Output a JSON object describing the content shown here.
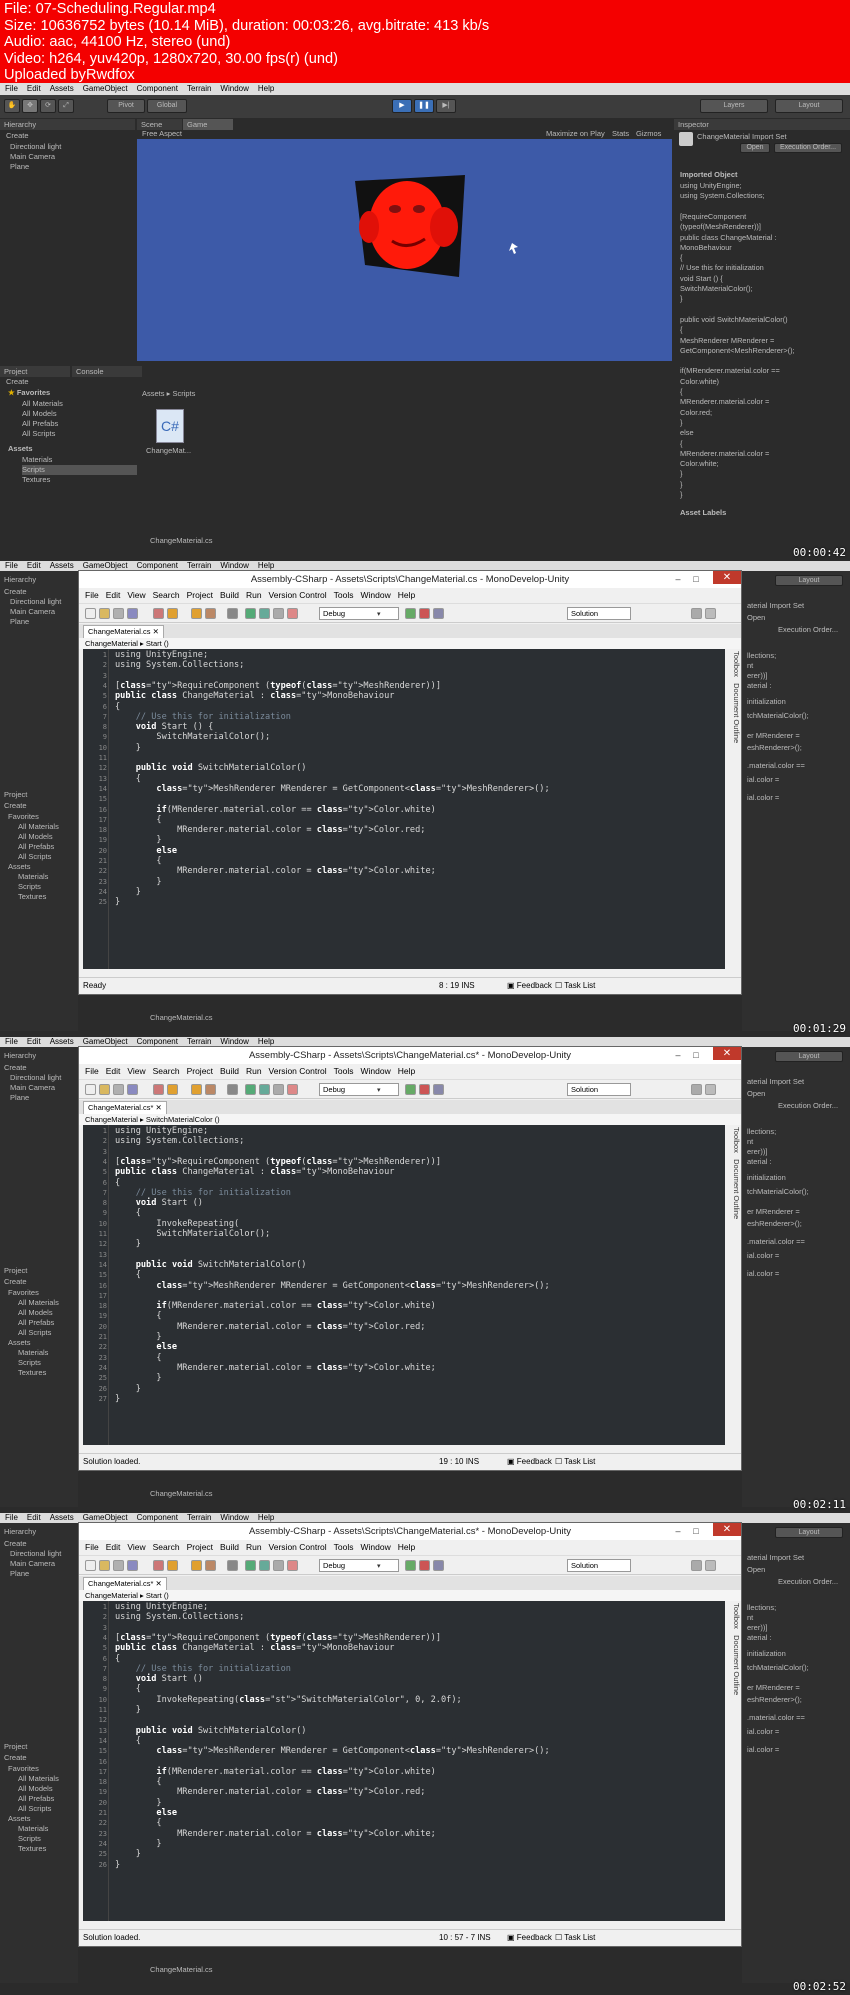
{
  "header": {
    "lines": [
      "File: 07-Scheduling.Regular.mp4",
      "Size: 10636752 bytes (10.14 MiB), duration: 00:03:26, avg.bitrate: 413 kb/s",
      "Audio: aac, 44100 Hz, stereo (und)",
      "Video: h264, yuv420p, 1280x720, 30.00 fps(r) (und)",
      "Uploaded byRwdfox"
    ]
  },
  "frame1": {
    "timestamp": "00:00:42",
    "menu": [
      "File",
      "Edit",
      "Assets",
      "GameObject",
      "Component",
      "Terrain",
      "Window",
      "Help"
    ],
    "toolbar": {
      "pivot": "Pivot",
      "global": "Global",
      "layers": "Layers",
      "layout": "Layout"
    },
    "hierarchy": {
      "title": "Hierarchy",
      "create": "Create",
      "items": [
        "Directional light",
        "Main Camera",
        "Plane"
      ]
    },
    "scene_tab": "Scene",
    "game_tab": "Game",
    "free_aspect": "Free Aspect",
    "game_opts": [
      "Maximize on Play",
      "Stats",
      "Gizmos"
    ],
    "inspector": {
      "title": "Inspector",
      "asset": "ChangeMaterial Import Set",
      "open": "Open",
      "exec": "Execution Order...",
      "imported": "Imported Object",
      "code": [
        "using UnityEngine;",
        "using System.Collections;",
        "",
        "[RequireComponent",
        "(typeof(MeshRenderer))]",
        "public class ChangeMaterial :",
        "MonoBehaviour",
        "{",
        "    // Use this for initialization",
        "    void Start () {",
        "        SwitchMaterialColor();",
        "    }",
        "",
        "    public void SwitchMaterialColor()",
        "    {",
        "        MeshRenderer MRenderer =",
        "GetComponent<MeshRenderer>();",
        "",
        "        if(MRenderer.material.color ==",
        "Color.white)",
        "        {",
        "            MRenderer.material.color =",
        "Color.red;",
        "        }",
        "        else",
        "        {",
        "            MRenderer.material.color =",
        "Color.white;",
        "        }",
        "    }",
        "}"
      ],
      "labels": "Asset Labels"
    },
    "project": {
      "title": "Project",
      "console": "Console",
      "create": "Create",
      "favorites": "Favorites",
      "fav_items": [
        "All Materials",
        "All Models",
        "All Prefabs",
        "All Scripts"
      ],
      "assets": "Assets",
      "asset_items": [
        "Materials",
        "Scripts",
        "Textures"
      ],
      "breadcrumb": "Assets ▸ Scripts",
      "file": "ChangeMat...",
      "status_file": "ChangeMaterial.cs"
    }
  },
  "md_common": {
    "menu": [
      "File",
      "Edit",
      "View",
      "Search",
      "Project",
      "Build",
      "Run",
      "Version Control",
      "Tools",
      "Window",
      "Help"
    ],
    "config": "Debug",
    "solution": "Solution",
    "feedback": "Feedback",
    "task_list": "Task List",
    "toolbox": "Toolbox",
    "doc_outline": "Document Outline",
    "unity_file": "ChangeMaterial.cs",
    "bg_hier": [
      "Hierarchy",
      "Create",
      "Directional light",
      "Main Camera",
      "Plane"
    ],
    "bg_proj": [
      "Project",
      "Create",
      "Favorites",
      "All Materials",
      "All Models",
      "All Prefabs",
      "All Scripts",
      "Assets",
      "Materials",
      "Scripts",
      "Textures"
    ],
    "bg_menu": [
      "File",
      "Edit",
      "Assets",
      "GameObject",
      "Component",
      "Terrain",
      "Window",
      "Help"
    ],
    "bg_layout": "Layout",
    "bg_insp": [
      "aterial Import Set",
      "Open",
      "Execution Order...",
      "llections;",
      "nt",
      "erer))]",
      "aterial :",
      "initialization",
      "tchMaterialColor();",
      "er MRenderer =",
      "eshRenderer>();",
      ".material.color ==",
      "ial.color =",
      "ial.color ="
    ]
  },
  "frame2": {
    "timestamp": "00:01:29",
    "title": "Assembly-CSharp - Assets\\Scripts\\ChangeMaterial.cs - MonoDevelop-Unity",
    "tab": "ChangeMaterial.cs",
    "bc": [
      "ChangeMaterial ▸",
      "Start ()"
    ],
    "status": "Ready",
    "pos": "8 : 19  INS",
    "lines": [
      [
        "using UnityEngine;"
      ],
      [
        "using System.Collections;"
      ],
      [
        ""
      ],
      [
        "[RequireComponent (typeof(MeshRenderer))]"
      ],
      [
        "public class ChangeMaterial : MonoBehaviour"
      ],
      [
        "{"
      ],
      [
        "    // Use this for initialization"
      ],
      [
        "    void Start () {"
      ],
      [
        "        SwitchMaterialColor();"
      ],
      [
        "    }"
      ],
      [
        ""
      ],
      [
        "    public void SwitchMaterialColor()"
      ],
      [
        "    {"
      ],
      [
        "        MeshRenderer MRenderer = GetComponent<MeshRenderer>();"
      ],
      [
        ""
      ],
      [
        "        if(MRenderer.material.color == Color.white)"
      ],
      [
        "        {"
      ],
      [
        "            MRenderer.material.color = Color.red;"
      ],
      [
        "        }"
      ],
      [
        "        else"
      ],
      [
        "        {"
      ],
      [
        "            MRenderer.material.color = Color.white;"
      ],
      [
        "        }"
      ],
      [
        "    }"
      ],
      [
        "}"
      ]
    ]
  },
  "frame3": {
    "timestamp": "00:02:11",
    "title": "Assembly-CSharp - Assets\\Scripts\\ChangeMaterial.cs* - MonoDevelop-Unity",
    "tab": "ChangeMaterial.cs*",
    "bc": [
      "ChangeMaterial ▸",
      "SwitchMaterialColor ()"
    ],
    "status": "Solution loaded.",
    "pos": "19 : 10  INS",
    "lines": [
      [
        "using UnityEngine;"
      ],
      [
        "using System.Collections;"
      ],
      [
        ""
      ],
      [
        "[RequireComponent (typeof(MeshRenderer))]"
      ],
      [
        "public class ChangeMaterial : MonoBehaviour"
      ],
      [
        "{"
      ],
      [
        "    // Use this for initialization"
      ],
      [
        "    void Start ()"
      ],
      [
        "    {"
      ],
      [
        "        InvokeRepeating("
      ],
      [
        "        SwitchMaterialColor();"
      ],
      [
        "    }"
      ],
      [
        ""
      ],
      [
        "    public void SwitchMaterialColor()"
      ],
      [
        "    {"
      ],
      [
        "        MeshRenderer MRenderer = GetComponent<MeshRenderer>();"
      ],
      [
        ""
      ],
      [
        "        if(MRenderer.material.color == Color.white)"
      ],
      [
        "        {"
      ],
      [
        "            MRenderer.material.color = Color.red;"
      ],
      [
        "        }"
      ],
      [
        "        else"
      ],
      [
        "        {"
      ],
      [
        "            MRenderer.material.color = Color.white;"
      ],
      [
        "        }"
      ],
      [
        "    }"
      ],
      [
        "}"
      ]
    ]
  },
  "frame4": {
    "timestamp": "00:02:52",
    "title": "Assembly-CSharp - Assets\\Scripts\\ChangeMaterial.cs* - MonoDevelop-Unity",
    "tab": "ChangeMaterial.cs*",
    "bc": [
      "ChangeMaterial ▸",
      "Start ()"
    ],
    "status": "Solution loaded.",
    "pos": "10 : 57 - 7  INS",
    "lines": [
      [
        "using UnityEngine;"
      ],
      [
        "using System.Collections;"
      ],
      [
        ""
      ],
      [
        "[RequireComponent (typeof(MeshRenderer))]"
      ],
      [
        "public class ChangeMaterial : MonoBehaviour"
      ],
      [
        "{"
      ],
      [
        "    // Use this for initialization"
      ],
      [
        "    void Start ()"
      ],
      [
        "    {"
      ],
      [
        "        InvokeRepeating(\"SwitchMaterialColor\", 0, 2.0f);"
      ],
      [
        "    }"
      ],
      [
        ""
      ],
      [
        "    public void SwitchMaterialColor()"
      ],
      [
        "    {"
      ],
      [
        "        MeshRenderer MRenderer = GetComponent<MeshRenderer>();"
      ],
      [
        ""
      ],
      [
        "        if(MRenderer.material.color == Color.white)"
      ],
      [
        "        {"
      ],
      [
        "            MRenderer.material.color = Color.red;"
      ],
      [
        "        }"
      ],
      [
        "        else"
      ],
      [
        "        {"
      ],
      [
        "            MRenderer.material.color = Color.white;"
      ],
      [
        "        }"
      ],
      [
        "    }"
      ],
      [
        "}"
      ]
    ]
  },
  "colors": {
    "header": "#f40000",
    "game_bg": "#3d5aa8",
    "editor_bg": "#2b2f33",
    "keyword": "#ffffff",
    "type": "#94c93d",
    "string": "#e69c3a"
  }
}
